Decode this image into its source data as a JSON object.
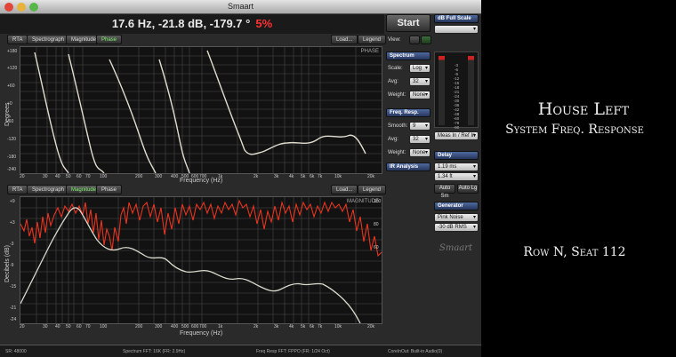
{
  "window": {
    "title": "Smaart"
  },
  "readout": {
    "values": "17.6 Hz, -21.8 dB, -179.7 °",
    "percent": "5%"
  },
  "top_plot": {
    "tabs": [
      "RTA",
      "Spectrograph",
      "Magnitude",
      "Phase"
    ],
    "active_tab": "Phase",
    "buttons": {
      "load": "Load...",
      "legend": "Legend"
    },
    "corner_label": "PHASE",
    "y_axis_label": "Degrees",
    "x_axis_label": "Frequency (Hz)",
    "y_ticks": [
      "+180",
      "+150",
      "+120",
      "+90",
      "+60",
      "+30",
      "+0",
      "-30",
      "-60",
      "-90",
      "-120",
      "-150",
      "-180",
      "-210",
      "-240"
    ],
    "x_ticks": [
      "20",
      "30",
      "40",
      "50",
      "60",
      "70",
      "80",
      "100",
      "200",
      "300",
      "400",
      "500",
      "600",
      "700",
      "1k",
      "2k",
      "3k",
      "4k",
      "5k",
      "6k",
      "7k",
      "8k",
      "10k",
      "20k"
    ]
  },
  "bottom_plot": {
    "tabs": [
      "RTA",
      "Spectrograph",
      "Magnitude",
      "Phase"
    ],
    "active_tab": "Magnitude",
    "buttons": {
      "load": "Load...",
      "legend": "Legend"
    },
    "corner_label": "MAGNITUDE",
    "y_axis_label": "Decibels (dB)",
    "x_axis_label": "Frequency (Hz)",
    "y_ticks": [
      "+9",
      "+6",
      "+3",
      "+0",
      "-3",
      "-6",
      "-9",
      "-12",
      "-15",
      "-18",
      "-21",
      "-24"
    ],
    "right_ticks": [
      "100",
      "90",
      "80",
      "70",
      "60",
      "50",
      "40",
      "30",
      "20",
      "10",
      "0"
    ],
    "x_ticks": [
      "20",
      "30",
      "40",
      "50",
      "60",
      "70",
      "80",
      "100",
      "200",
      "300",
      "400",
      "500",
      "600",
      "700",
      "1k",
      "2k",
      "3k",
      "4k",
      "5k",
      "6k",
      "7k",
      "8k",
      "10k",
      "20k"
    ]
  },
  "controls": {
    "start": "Start",
    "full_scale": "dB Full Scale",
    "view_label": "View:",
    "spectrum": {
      "header": "Spectrum",
      "scale_label": "Scale:",
      "scale": "Log",
      "avg_label": "Avg:",
      "avg": "32",
      "weight_label": "Weight:",
      "weight": "None"
    },
    "freq_resp": {
      "header": "Freq. Resp.",
      "smoothing_label": "Smooth:",
      "smoothing": "9",
      "avg_label": "Avg:",
      "avg": "32",
      "weight_label": "Weight:",
      "weight": "None"
    },
    "ir_analysis": "IR Analysis",
    "meter_ticks": [
      "-3",
      "-6",
      "-9",
      "-12",
      "-15",
      "-18",
      "-21",
      "-24",
      "-30",
      "-36",
      "-42",
      "-48",
      "-60",
      "-78",
      "-90"
    ],
    "meas_ref": "Meas In / Ref In",
    "delay": {
      "header": "Delay",
      "ms": "1.19 ms",
      "ft": "1.34 ft",
      "auto_sm": "Auto Sm",
      "auto_lg": "Auto Lg"
    },
    "generator": {
      "header": "Generator",
      "type": "Pink Noise",
      "level": "-30 dB",
      "mode": "RMS"
    },
    "logo": "Smaart"
  },
  "status": {
    "sr": "SR: 48000",
    "spectrum_fft": "Spectrum FFT: 16K (FR: 2.9Hz)",
    "freq_fft": "Freq Resp FFT: FPPO (FR: 1/24 Oct)",
    "io": "CoreInOut: Built-in Audio(0)"
  },
  "slide": {
    "title_line1": "House Left",
    "title_line2": "System Freq. Response",
    "seat": "Row N, Seat 112"
  },
  "colors": {
    "magnitude_trace": "#e8341f",
    "phase_trace": "#e0ddcf",
    "coherence_trace": "#d8d8cc",
    "active_tab": "#7cf06a",
    "percent": "#ff3030"
  }
}
